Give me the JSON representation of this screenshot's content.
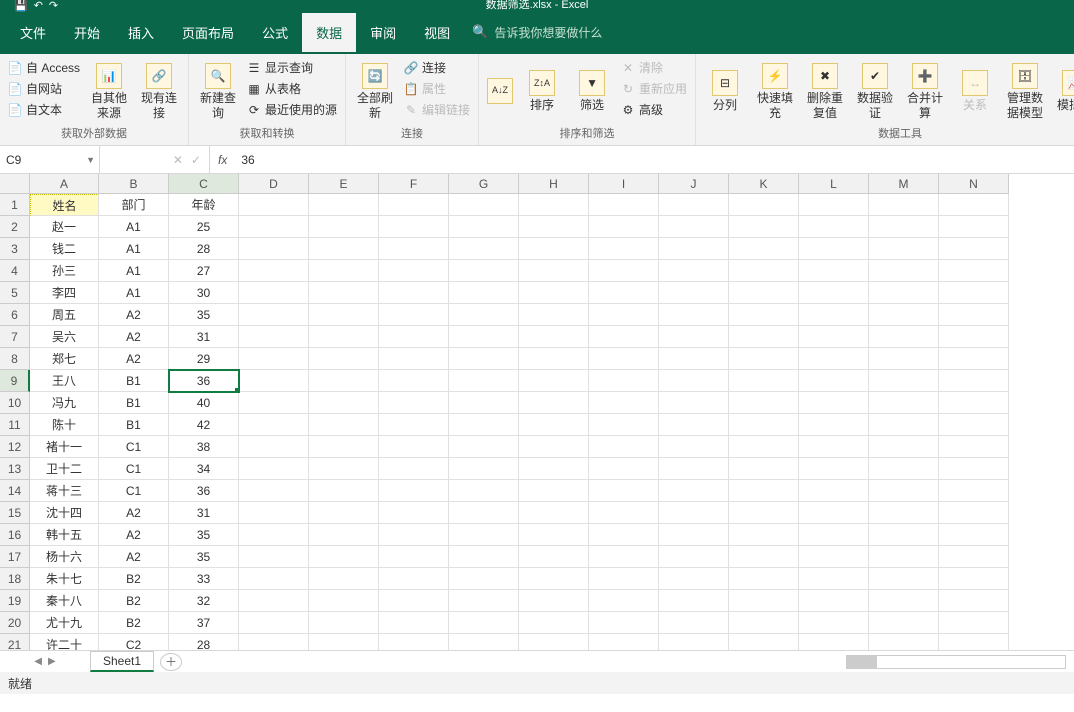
{
  "app": {
    "title": "数据筛选.xlsx - Excel"
  },
  "tabs": {
    "file": "文件",
    "home": "开始",
    "insert": "插入",
    "layout": "页面布局",
    "formula": "公式",
    "data": "数据",
    "review": "审阅",
    "view": "视图"
  },
  "search": {
    "placeholder": "告诉我你想要做什么"
  },
  "ribbon": {
    "ext": {
      "access": "自 Access",
      "web": "自网站",
      "text": "自文本",
      "other": "自其他来源",
      "existing": "现有连接",
      "label": "获取外部数据"
    },
    "get": {
      "new": "新建查询",
      "show": "显示查询",
      "table": "从表格",
      "recent": "最近使用的源",
      "label": "获取和转换"
    },
    "conn": {
      "refresh": "全部刷新",
      "conn": "连接",
      "prop": "属性",
      "edit": "编辑链接",
      "label": "连接"
    },
    "sortfilter": {
      "sort": "排序",
      "filter": "筛选",
      "clear": "清除",
      "reapply": "重新应用",
      "adv": "高级",
      "label": "排序和筛选"
    },
    "tools": {
      "tocol": "分列",
      "flash": "快速填充",
      "dup": "删除重复值",
      "valid": "数据验证",
      "consol": "合并计算",
      "rel": "关系",
      "model": "管理数据模型",
      "whatif": "模拟分",
      "label": "数据工具"
    }
  },
  "namebox": "C9",
  "formula": "36",
  "columns": [
    "A",
    "B",
    "C",
    "D",
    "E",
    "F",
    "G",
    "H",
    "I",
    "J",
    "K",
    "L",
    "M",
    "N"
  ],
  "header_row": {
    "a": "姓名",
    "b": "部门",
    "c": "年龄"
  },
  "rows": [
    {
      "a": "赵一",
      "b": "A1",
      "c": "25"
    },
    {
      "a": "钱二",
      "b": "A1",
      "c": "28"
    },
    {
      "a": "孙三",
      "b": "A1",
      "c": "27"
    },
    {
      "a": "李四",
      "b": "A1",
      "c": "30"
    },
    {
      "a": "周五",
      "b": "A2",
      "c": "35"
    },
    {
      "a": "吴六",
      "b": "A2",
      "c": "31"
    },
    {
      "a": "郑七",
      "b": "A2",
      "c": "29"
    },
    {
      "a": "王八",
      "b": "B1",
      "c": "36"
    },
    {
      "a": "冯九",
      "b": "B1",
      "c": "40"
    },
    {
      "a": "陈十",
      "b": "B1",
      "c": "42"
    },
    {
      "a": "褚十一",
      "b": "C1",
      "c": "38"
    },
    {
      "a": "卫十二",
      "b": "C1",
      "c": "34"
    },
    {
      "a": "蒋十三",
      "b": "C1",
      "c": "36"
    },
    {
      "a": "沈十四",
      "b": "A2",
      "c": "31"
    },
    {
      "a": "韩十五",
      "b": "A2",
      "c": "35"
    },
    {
      "a": "杨十六",
      "b": "A2",
      "c": "35"
    },
    {
      "a": "朱十七",
      "b": "B2",
      "c": "33"
    },
    {
      "a": "秦十八",
      "b": "B2",
      "c": "32"
    },
    {
      "a": "尤十九",
      "b": "B2",
      "c": "37"
    },
    {
      "a": "许二十",
      "b": "C2",
      "c": "28"
    }
  ],
  "active": {
    "row": 9,
    "col": "C"
  },
  "sheet": {
    "name": "Sheet1"
  },
  "status": {
    "text": "就绪"
  }
}
